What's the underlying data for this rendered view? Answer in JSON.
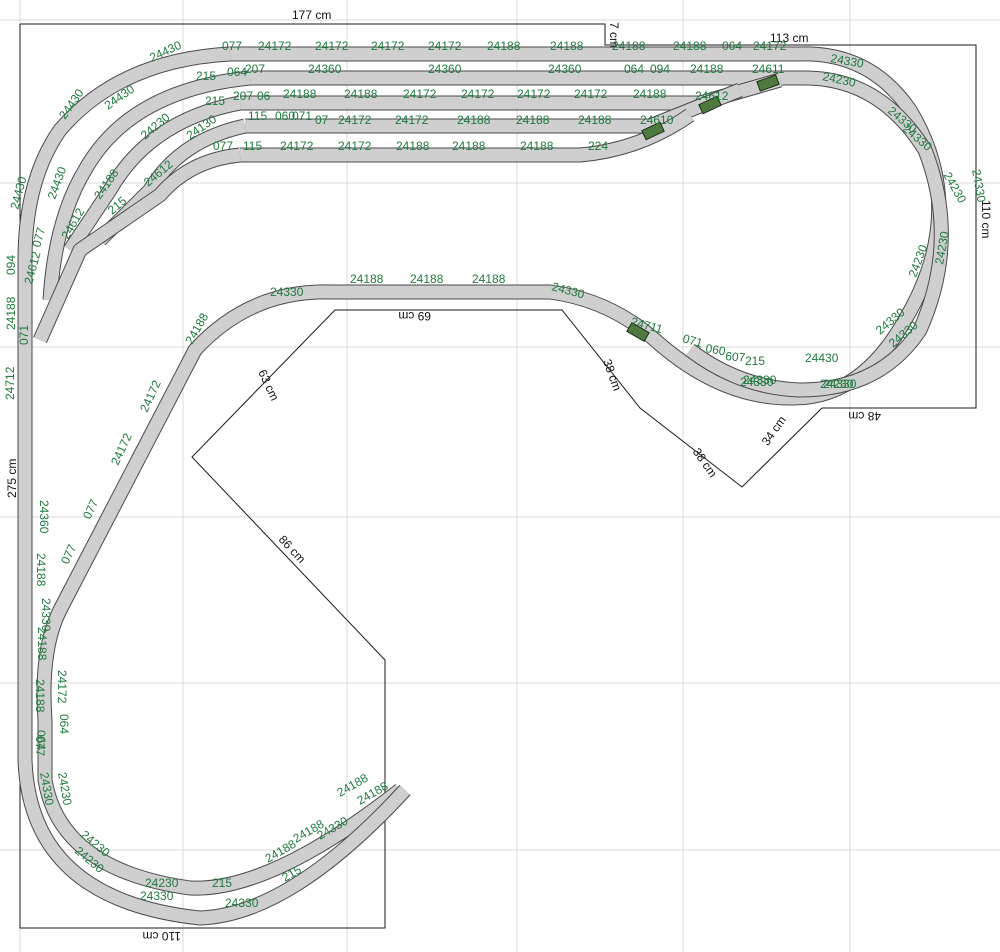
{
  "plan": {
    "dimensions": [
      {
        "id": "top-width",
        "text": "177 cm"
      },
      {
        "id": "notch-height",
        "text": "7 cm"
      },
      {
        "id": "right-top-width",
        "text": "113 cm"
      },
      {
        "id": "right-height",
        "text": "110 cm"
      },
      {
        "id": "right-bottom-width",
        "text": "48 cm"
      },
      {
        "id": "left-height",
        "text": "275 cm"
      },
      {
        "id": "bottom-width",
        "text": "110 cm"
      },
      {
        "id": "inner-top",
        "text": "69 cm"
      },
      {
        "id": "inner-left-diag",
        "text": "63 cm"
      },
      {
        "id": "inner-long-diag",
        "text": "86 cm"
      },
      {
        "id": "inner-right-a",
        "text": "38 cm"
      },
      {
        "id": "inner-right-b",
        "text": "38 cm"
      },
      {
        "id": "inner-right-c",
        "text": "34 cm"
      }
    ],
    "track_labels": [
      "077",
      "24172",
      "24172",
      "24172",
      "24172",
      "24188",
      "24188",
      "24188",
      "24188",
      "064",
      "24172",
      "24330",
      "24430",
      "215",
      "064",
      "207",
      "24360",
      "24360",
      "24360",
      "064",
      "094",
      "24188",
      "24611",
      "24230",
      "24430",
      "24430",
      "215",
      "207",
      "06",
      "24188",
      "24188",
      "24172",
      "24172",
      "24172",
      "24172",
      "24188",
      "24612",
      "24330",
      "24230",
      "24130",
      "115",
      "060",
      "071",
      "07",
      "24172",
      "24172",
      "24188",
      "24188",
      "24188",
      "24610",
      "24330",
      "077",
      "115",
      "24172",
      "24172",
      "24188",
      "24188",
      "24188",
      "224",
      "24230",
      "24330",
      "24430",
      "24430",
      "24188",
      "24612",
      "24612",
      "215",
      "077",
      "24612",
      "094",
      "24188",
      "071",
      "24712",
      "24330",
      "24188",
      "24188",
      "24188",
      "24330",
      "24711",
      "071",
      "060",
      "607",
      "215",
      "24430",
      "24230",
      "24230",
      "24330",
      "24330",
      "24330",
      "24188",
      "24172",
      "24172",
      "077",
      "077",
      "24360",
      "24188",
      "24330",
      "24188",
      "24172",
      "064",
      "064",
      "24188",
      "077",
      "24330",
      "24230",
      "24230",
      "24230",
      "24230",
      "215",
      "24188",
      "24188",
      "24188",
      "24188",
      "24330",
      "24330",
      "215",
      "24330",
      "24230",
      "24330",
      "24330"
    ]
  }
}
